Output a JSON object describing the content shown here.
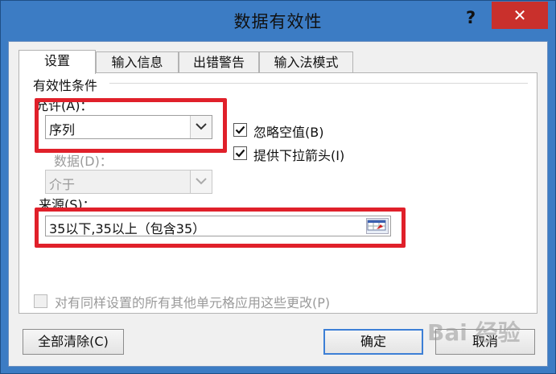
{
  "window": {
    "title": "数据有效性",
    "help_label": "?",
    "close_label": "✕"
  },
  "tabs": [
    {
      "label": "设置",
      "active": true
    },
    {
      "label": "输入信息",
      "active": false
    },
    {
      "label": "出错警告",
      "active": false
    },
    {
      "label": "输入法模式",
      "active": false
    }
  ],
  "section_title": "有效性条件",
  "allow": {
    "label": "允许(A)：",
    "value": "序列"
  },
  "data": {
    "label": "数据(D)：",
    "value": "介于"
  },
  "checkboxes": {
    "ignore_blank": {
      "label": "忽略空值(B)",
      "checked": true
    },
    "dropdown": {
      "label": "提供下拉箭头(I)",
      "checked": true
    },
    "apply_all": {
      "label": "对有同样设置的所有其他单元格应用这些更改(P)",
      "checked": false
    }
  },
  "source": {
    "label": "来源(S)：",
    "value": "35以下,35以上（包含35）"
  },
  "buttons": {
    "clear_all": "全部清除(C)",
    "ok": "确定",
    "cancel": "取消"
  },
  "watermark": "Bai 经验",
  "colors": {
    "highlight": "#e0202a",
    "close": "#c9302c",
    "title_bar": "#3c7cc4"
  }
}
